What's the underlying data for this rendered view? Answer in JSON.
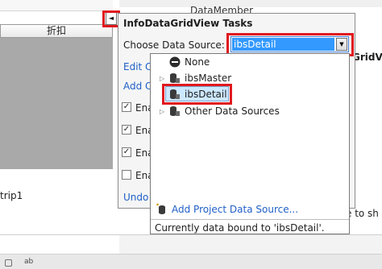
{
  "designer": {
    "column_header": "折扣",
    "tray_label": "trip1"
  },
  "property_grid": {
    "datamember_label": "DataMember",
    "gridview_fragment": "GridV",
    "description_fragment": "e to sh"
  },
  "smart_tag": {
    "glyph": "◄"
  },
  "tasks_panel": {
    "title": "InfoDataGridView Tasks",
    "choose_label": "Choose Data Source:",
    "selected_source": "ibsDetail",
    "dropdown_glyph": "▼",
    "edit_link": "Edit C",
    "add_link": "Add C",
    "undock_link": "Undo",
    "checkboxes": [
      {
        "label": "Ena",
        "checked": true
      },
      {
        "label": "Ena",
        "checked": true
      },
      {
        "label": "Ena",
        "checked": true
      },
      {
        "label": "Ena",
        "checked": false
      }
    ],
    "check_glyph": "✓"
  },
  "data_source_tree": {
    "items": [
      {
        "label": "None",
        "icon": "none-icon",
        "expander": ""
      },
      {
        "label": "ibsMaster",
        "icon": "database-icon",
        "expander": "▷"
      },
      {
        "label": "ibsDetail",
        "icon": "database-icon",
        "expander": "",
        "selected": true
      },
      {
        "label": "Other Data Sources",
        "icon": "database-icon",
        "expander": "▷"
      }
    ],
    "add_project_link": "Add Project Data Source...",
    "status": "Currently data bound to 'ibsDetail'."
  },
  "colors": {
    "highlight_red": "#e0191f",
    "selection_blue": "#3399ff",
    "link_blue": "#1f5fc7",
    "grid_gray": "#a9a9a9"
  }
}
